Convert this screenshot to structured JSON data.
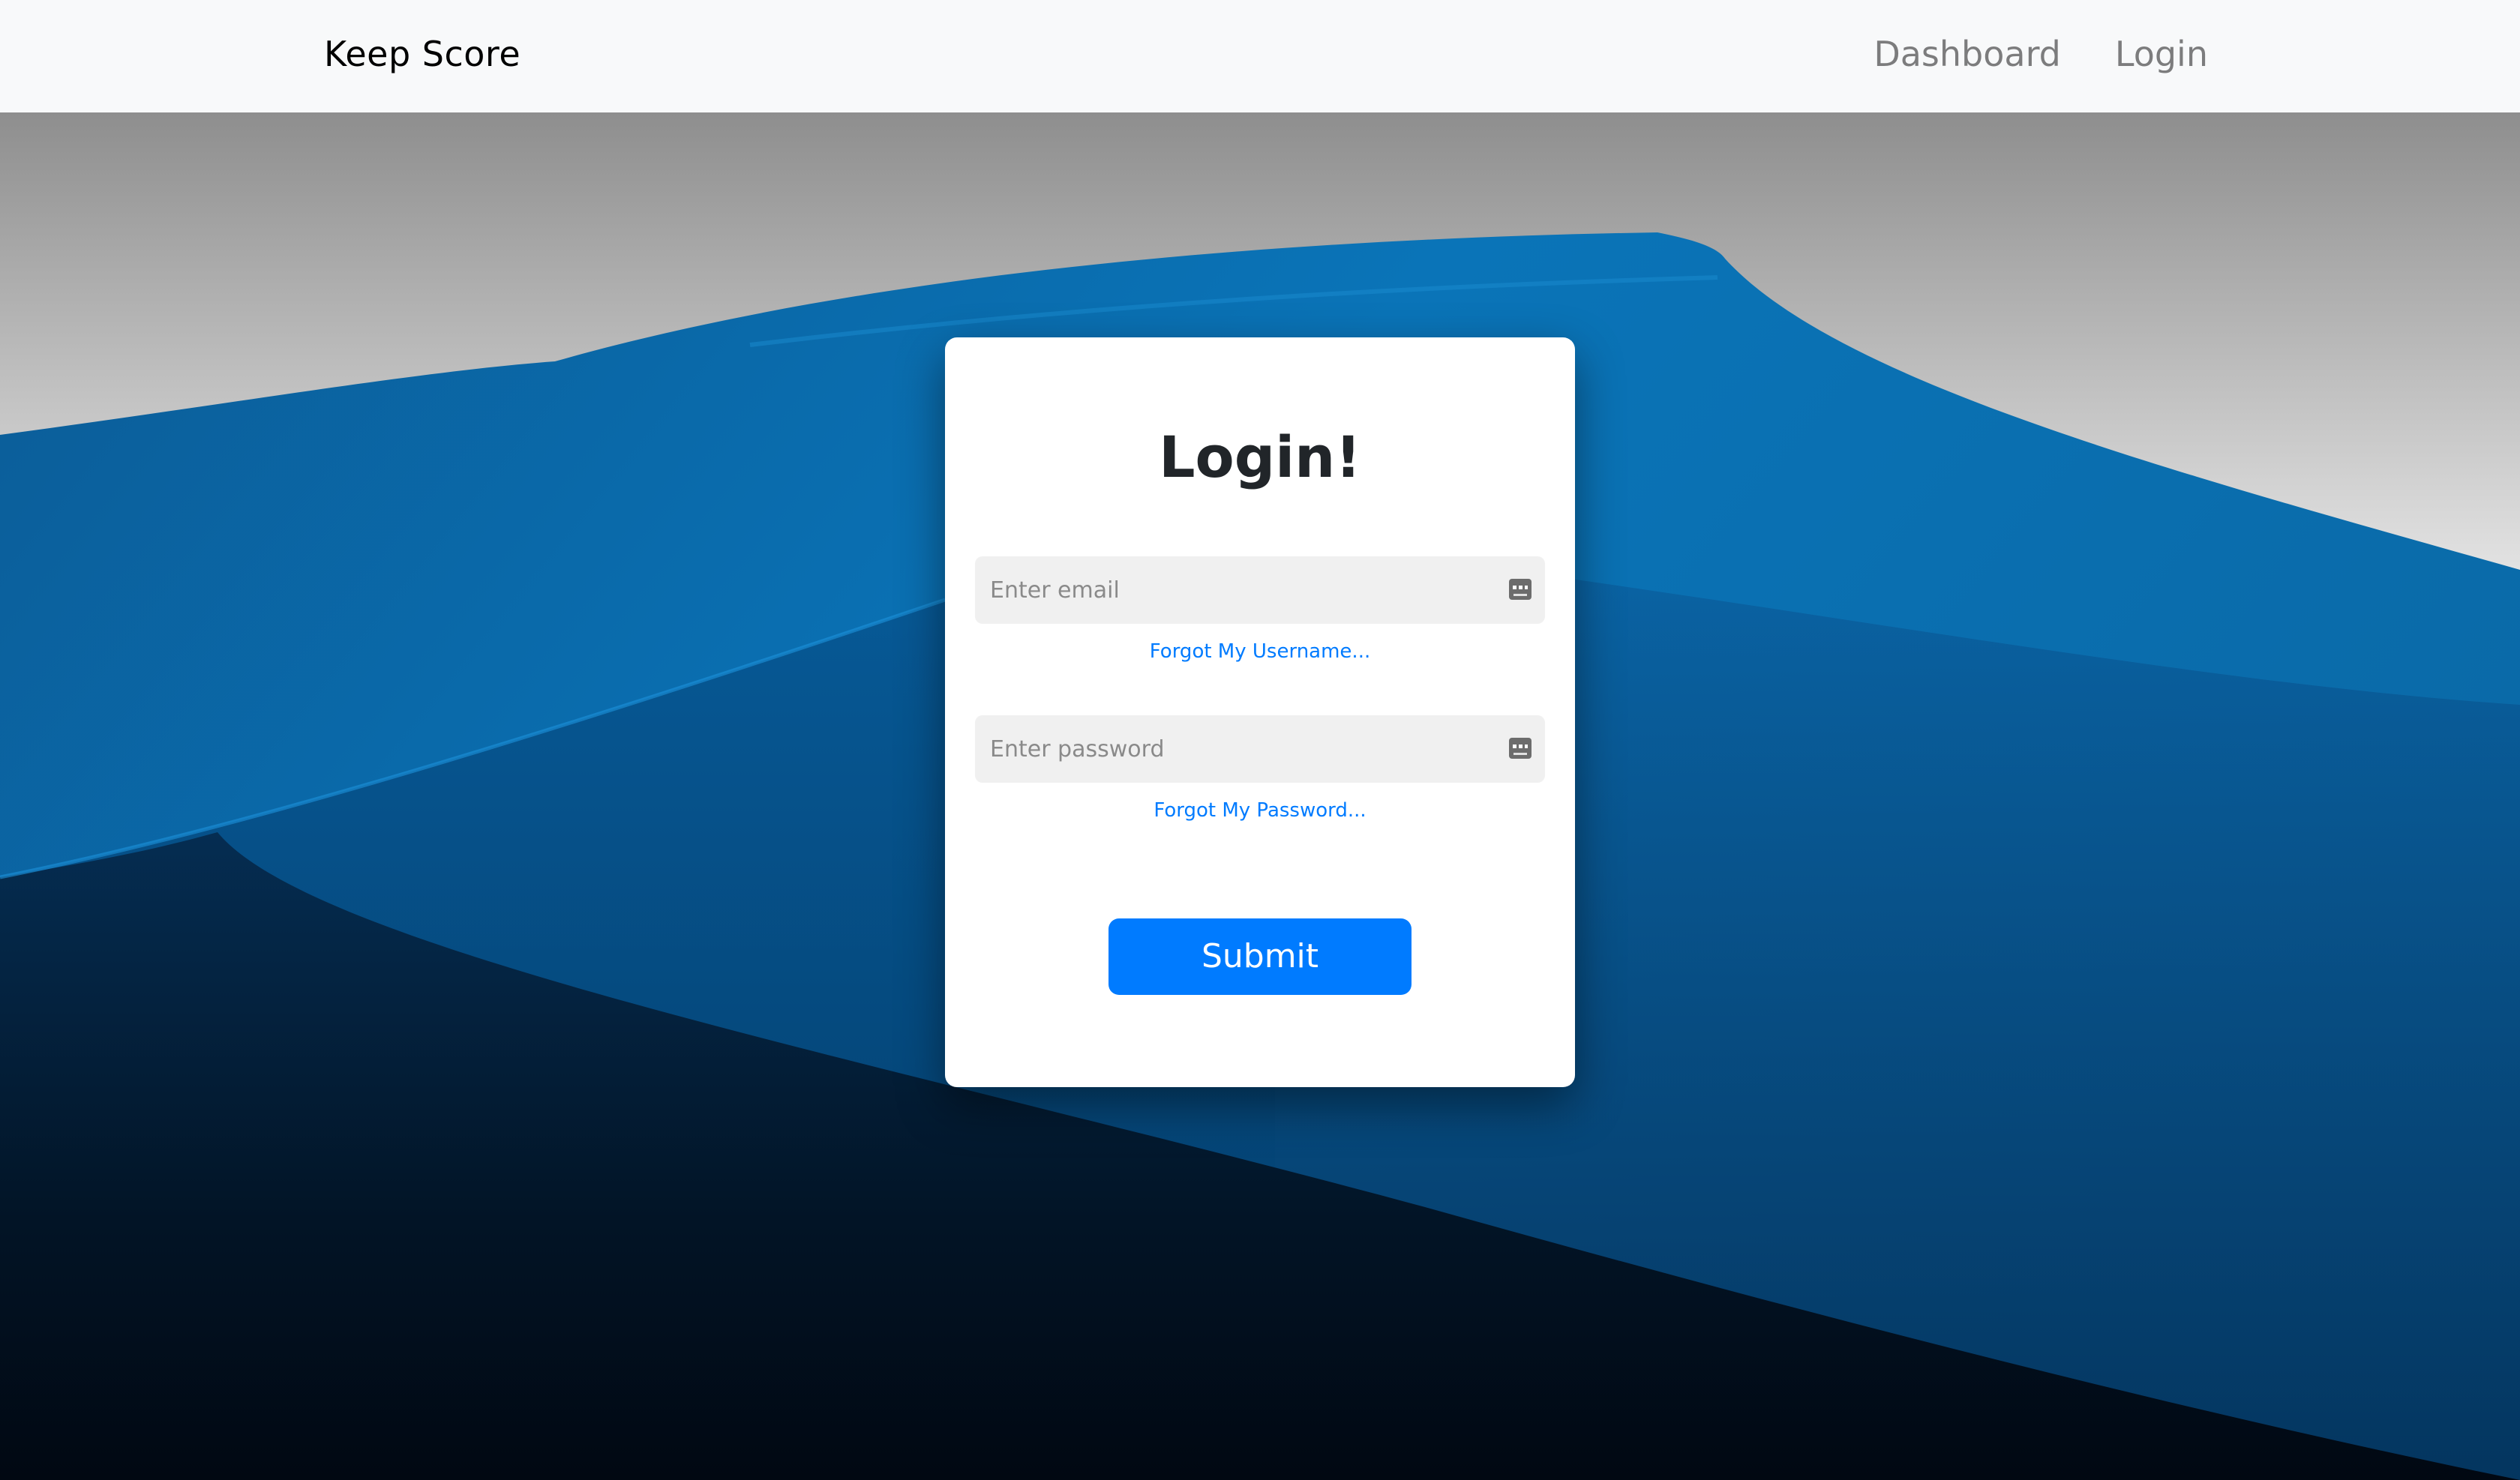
{
  "navbar": {
    "brand": "Keep Score",
    "links": [
      {
        "label": "Dashboard"
      },
      {
        "label": "Login"
      }
    ]
  },
  "login_card": {
    "title": "Login!",
    "email": {
      "placeholder": "Enter email",
      "value": "",
      "forgot_label": "Forgot My Username..."
    },
    "password": {
      "placeholder": "Enter password",
      "value": "",
      "forgot_label": "Forgot My Password..."
    },
    "submit_label": "Submit"
  },
  "icons": {
    "email_field_icon": "password-manager-key-icon",
    "password_field_icon": "password-manager-key-icon"
  },
  "colors": {
    "navbar_bg": "#f8f9fa",
    "brand_text": "#000000",
    "nav_link_text": "#7f7f7f",
    "primary": "#007bff",
    "card_bg": "#ffffff",
    "field_bg": "#f0f0f0",
    "background_dune_blue": "#0a5fa3",
    "background_sky": "#e9e9e9"
  }
}
